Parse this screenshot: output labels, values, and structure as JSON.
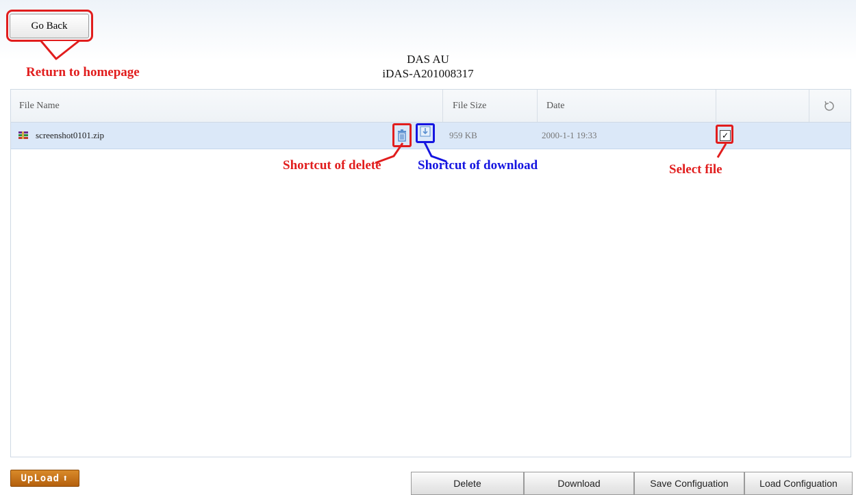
{
  "header": {
    "go_back_label": "Go Back",
    "title_line1": "DAS AU",
    "title_line2": "iDAS-A201008317"
  },
  "annotations": {
    "return_home": "Return to homepage",
    "shortcut_delete": "Shortcut of delete",
    "shortcut_download": "Shortcut of download",
    "select_file": "Select file"
  },
  "table": {
    "columns": [
      "File Name",
      "File Size",
      "Date"
    ],
    "refresh_icon": "refresh-icon",
    "rows": [
      {
        "name": "screenshot0101.zip",
        "size": "959 KB",
        "date": "2000-1-1 19:33",
        "selected": true
      }
    ]
  },
  "footer": {
    "upload_label": "UpLoad",
    "buttons": {
      "delete": "Delete",
      "download": "Download",
      "save": "Save Configuation",
      "load": "Load Configuation"
    }
  },
  "colors": {
    "annotation_red": "#e11d1d",
    "annotation_blue": "#1515e0",
    "selected_row": "#dbe8f8",
    "upload_orange": "#c8731a"
  }
}
